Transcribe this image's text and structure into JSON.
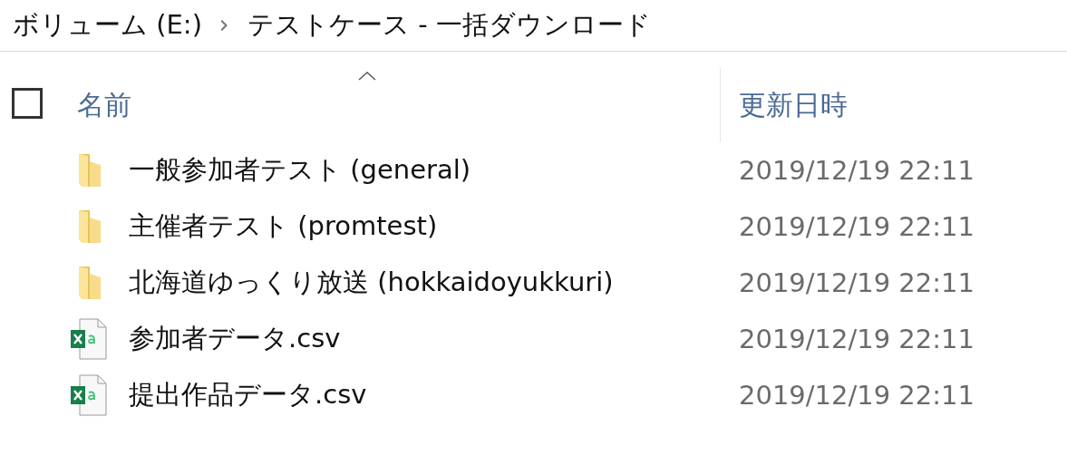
{
  "breadcrumb": [
    "ボリューム (E:)",
    "テストケース - 一括ダウンロード"
  ],
  "columns": [
    {
      "label": "名前",
      "sorted": true
    },
    {
      "label": "更新日時",
      "sorted": false
    }
  ],
  "select_all": {
    "checked": false
  },
  "files": [
    {
      "kind": "folder",
      "name": "一般参加者テスト (general)",
      "modified": "2019/12/19 22:11"
    },
    {
      "kind": "folder",
      "name": "主催者テスト (promtest)",
      "modified": "2019/12/19 22:11"
    },
    {
      "kind": "folder",
      "name": "北海道ゆっくり放送 (hokkaidoyukkuri)",
      "modified": "2019/12/19 22:11"
    },
    {
      "kind": "csv",
      "name": "参加者データ.csv",
      "modified": "2019/12/19 22:11"
    },
    {
      "kind": "csv",
      "name": "提出作品データ.csv",
      "modified": "2019/12/19 22:11"
    }
  ]
}
